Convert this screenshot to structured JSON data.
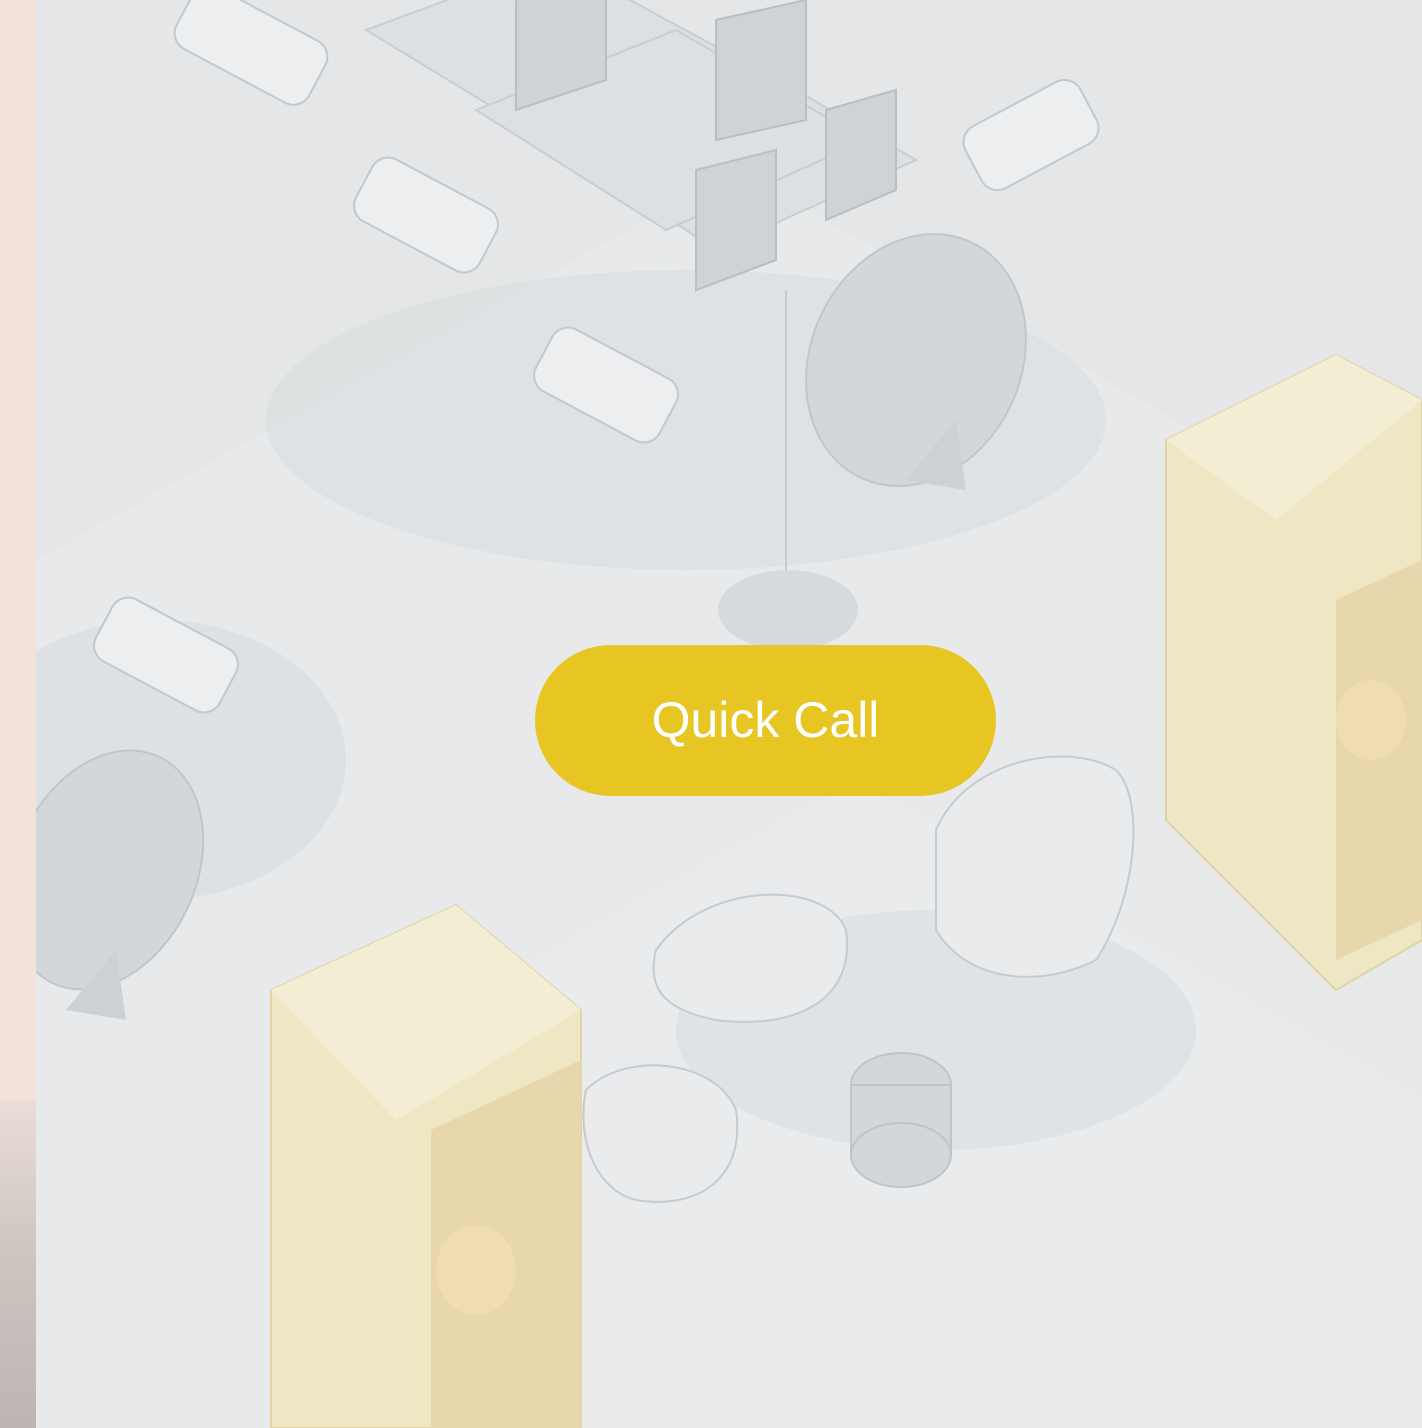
{
  "hero": {
    "cta_label": "Quick Call",
    "illustration_icon": "isometric-office-illustration"
  },
  "colors": {
    "cta_background": "#e7c523",
    "cta_text": "#ffffff",
    "page_edge": "#f3e2db",
    "floor": "#e4e6e7",
    "pod": "#efe7c4"
  }
}
